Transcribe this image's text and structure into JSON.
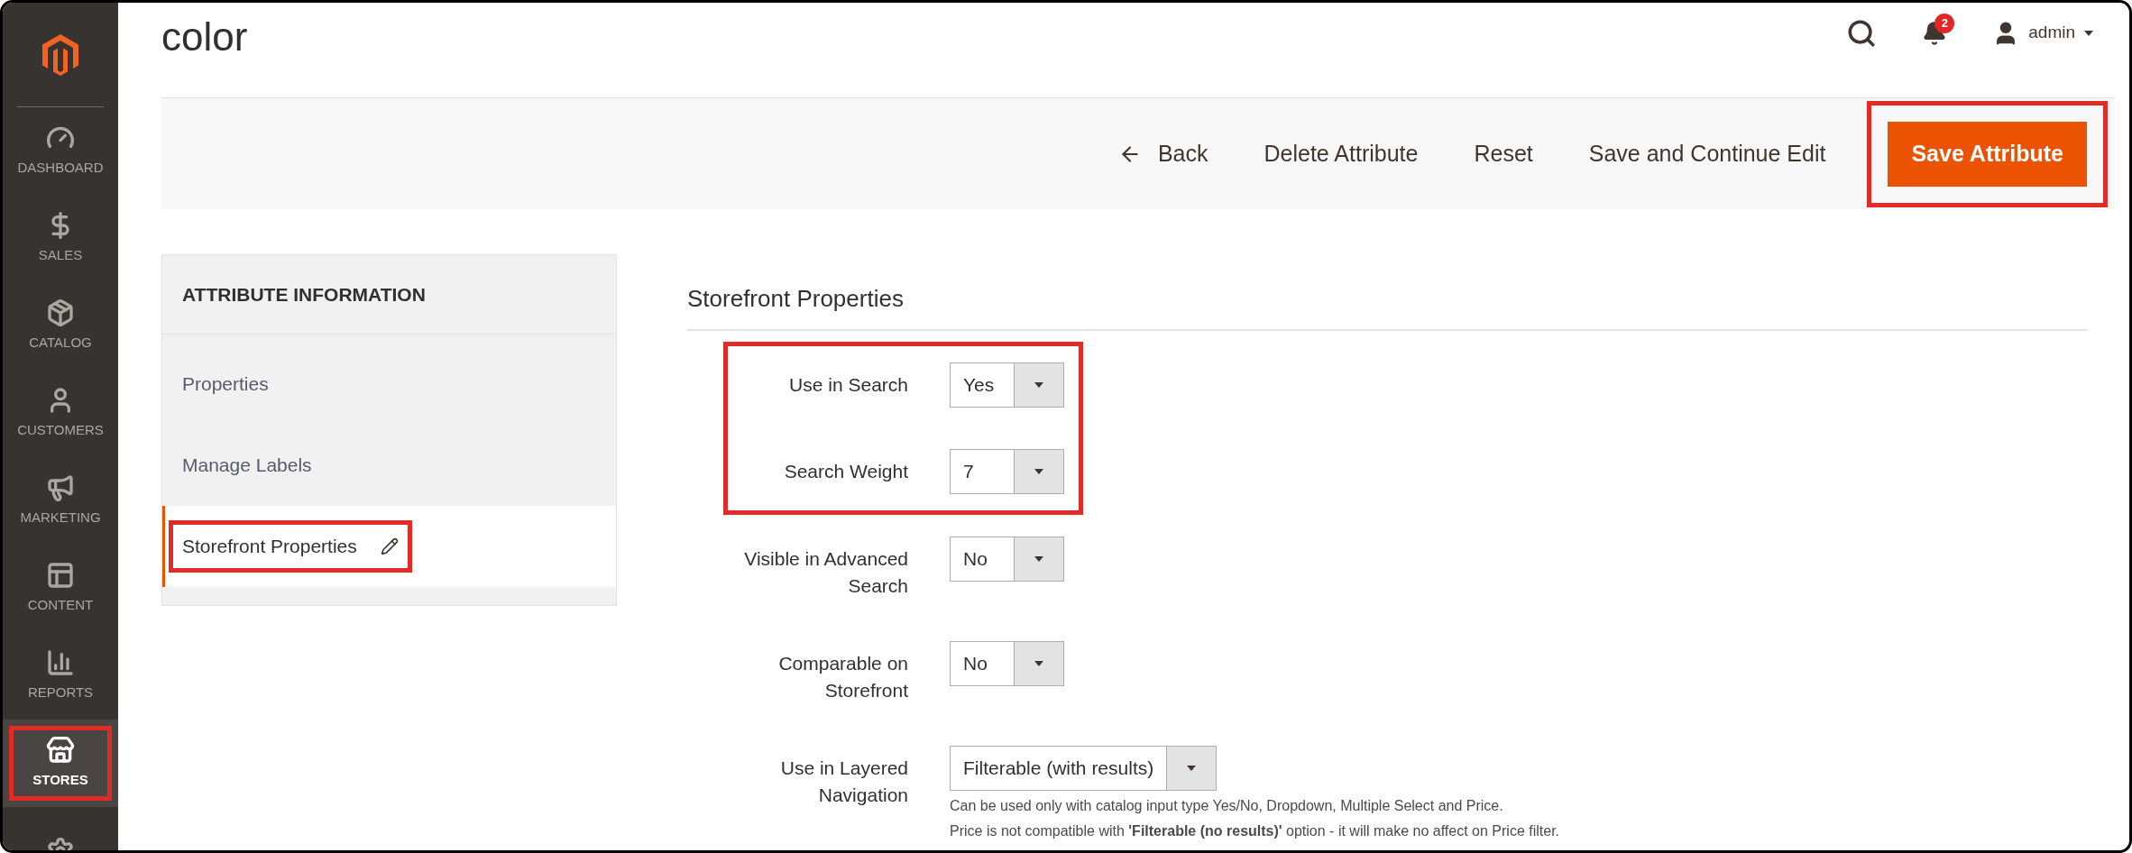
{
  "sidebar": {
    "items": [
      {
        "label": "DASHBOARD",
        "selected": false,
        "highlighted": false
      },
      {
        "label": "SALES",
        "selected": false,
        "highlighted": false
      },
      {
        "label": "CATALOG",
        "selected": false,
        "highlighted": false
      },
      {
        "label": "CUSTOMERS",
        "selected": false,
        "highlighted": false
      },
      {
        "label": "MARKETING",
        "selected": false,
        "highlighted": false
      },
      {
        "label": "CONTENT",
        "selected": false,
        "highlighted": false
      },
      {
        "label": "REPORTS",
        "selected": false,
        "highlighted": false
      },
      {
        "label": "STORES",
        "selected": true,
        "highlighted": true
      },
      {
        "selected": false,
        "highlighted": false
      }
    ]
  },
  "page": {
    "title": "color"
  },
  "header": {
    "notifications": "2",
    "user": "admin"
  },
  "toolbar": {
    "buttons": [
      {
        "kind": "back",
        "label": "Back",
        "highlighted": false
      },
      {
        "kind": "plain",
        "label": "Delete Attribute",
        "highlighted": false
      },
      {
        "kind": "plain",
        "label": "Reset",
        "highlighted": false
      },
      {
        "kind": "plain",
        "label": "Save and Continue Edit",
        "highlighted": false
      },
      {
        "kind": "primary",
        "label": "Save Attribute",
        "highlighted": true
      }
    ]
  },
  "tabs": {
    "heading": "ATTRIBUTE INFORMATION",
    "items": [
      {
        "label": "Properties",
        "selected": false,
        "highlighted": false
      },
      {
        "label": "Manage Labels",
        "selected": false,
        "highlighted": false
      },
      {
        "label": "Storefront Properties",
        "selected": true,
        "highlighted": true
      }
    ]
  },
  "section": {
    "title": "Storefront Properties",
    "highlighted_fields": [
      {
        "label": "Use in Search",
        "value": "Yes"
      },
      {
        "label": "Search Weight",
        "value": "7"
      }
    ],
    "fields": [
      {
        "label": "Visible in Advanced Search",
        "value": "No"
      },
      {
        "label": "Comparable on Storefront",
        "value": "No"
      },
      {
        "label": "Use in Layered Navigation",
        "value": "Filterable (with results)",
        "notes": [
          "Can be used only with catalog input type Yes/No, Dropdown, Multiple Select and Price.",
          "Price is not compatible with **'Filterable (no results)'** option - it will make no affect on Price filter."
        ]
      }
    ]
  }
}
